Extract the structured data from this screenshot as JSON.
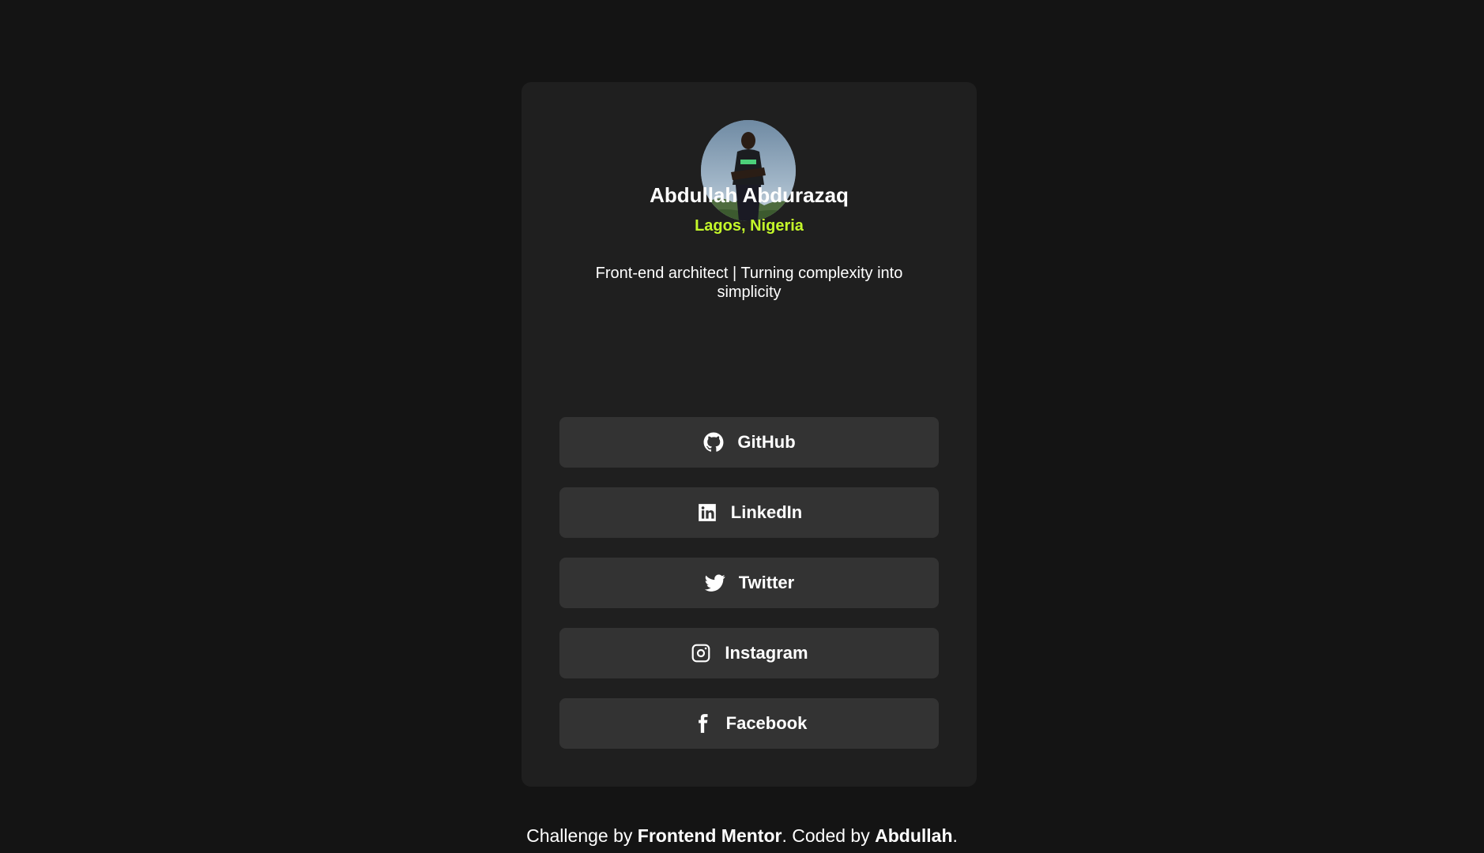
{
  "profile": {
    "name": "Abdullah Abdurazaq",
    "location": "Lagos, Nigeria",
    "bio": "Front-end architect | Turning complexity into simplicity"
  },
  "links": [
    {
      "label": "GitHub",
      "icon": "github-icon"
    },
    {
      "label": "LinkedIn",
      "icon": "linkedin-icon"
    },
    {
      "label": "Twitter",
      "icon": "twitter-icon"
    },
    {
      "label": "Instagram",
      "icon": "instagram-icon"
    },
    {
      "label": "Facebook",
      "icon": "facebook-icon"
    }
  ],
  "footer": {
    "prefix": "Challenge by ",
    "challenge_link": "Frontend Mentor",
    "middle": ". Coded by ",
    "author_link": "Abdullah",
    "suffix": "."
  },
  "colors": {
    "page_background": "#141414",
    "card_background": "#1f1f1f",
    "button_background": "#333333",
    "accent": "#c4f82a",
    "text": "#ffffff"
  }
}
